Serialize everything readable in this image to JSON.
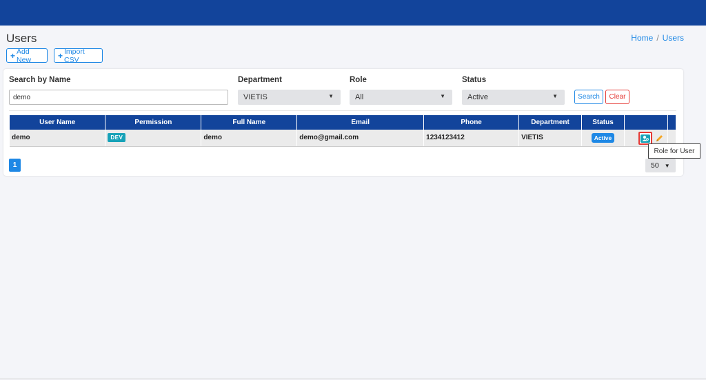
{
  "header": {
    "title": "Users"
  },
  "breadcrumb": {
    "home": "Home",
    "separator": "/",
    "current": "Users"
  },
  "toolbar": {
    "add_new": "Add New",
    "import_csv": "Import CSV",
    "plus_icon": "+"
  },
  "filters": {
    "search_label": "Search by Name",
    "search_value": "demo",
    "department_label": "Department",
    "department_value": "VIETIS",
    "role_label": "Role",
    "role_value": "All",
    "status_label": "Status",
    "status_value": "Active",
    "search_button": "Search",
    "clear_button": "Clear"
  },
  "table": {
    "columns": [
      "User Name",
      "Permission",
      "Full Name",
      "Email",
      "Phone",
      "Department",
      "Status"
    ],
    "rows": [
      {
        "user_name": "demo",
        "permission": "DEV",
        "full_name": "demo",
        "email": "demo@gmail.com",
        "phone": "1234123412",
        "department": "VIETIS",
        "status": "Active"
      }
    ]
  },
  "actions": {
    "role_icon": "user-role-icon",
    "edit_icon": "pencil-icon"
  },
  "pagination": {
    "current_page": "1",
    "per_page": "50"
  },
  "tooltip": {
    "text": "Role for User"
  },
  "colors": {
    "topbar": "#12449b",
    "primary": "#1e88e5",
    "danger": "#e53935",
    "info": "#17a2b8"
  }
}
